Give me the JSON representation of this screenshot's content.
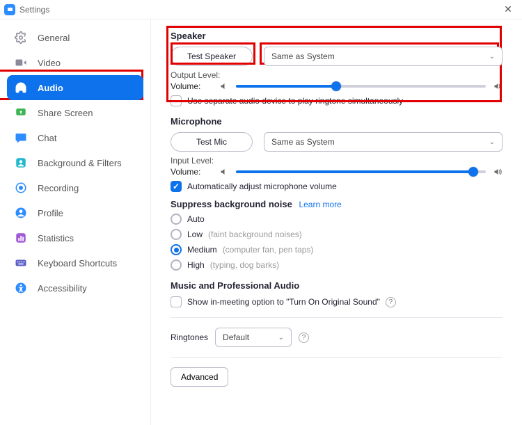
{
  "window": {
    "title": "Settings"
  },
  "sidebar": {
    "items": [
      {
        "label": "General"
      },
      {
        "label": "Video"
      },
      {
        "label": "Audio"
      },
      {
        "label": "Share Screen"
      },
      {
        "label": "Chat"
      },
      {
        "label": "Background & Filters"
      },
      {
        "label": "Recording"
      },
      {
        "label": "Profile"
      },
      {
        "label": "Statistics"
      },
      {
        "label": "Keyboard Shortcuts"
      },
      {
        "label": "Accessibility"
      }
    ],
    "active_index": 2
  },
  "speaker": {
    "title": "Speaker",
    "test_btn": "Test Speaker",
    "device": "Same as System",
    "output_level_label": "Output Level:",
    "volume_label": "Volume:",
    "volume_pct": 40,
    "separate_device_label": "Use separate audio device to play ringtone simultaneously",
    "separate_device_checked": false
  },
  "mic": {
    "title": "Microphone",
    "test_btn": "Test Mic",
    "device": "Same as System",
    "input_level_label": "Input Level:",
    "volume_label": "Volume:",
    "volume_pct": 95,
    "auto_adjust_label": "Automatically adjust microphone volume",
    "auto_adjust_checked": true
  },
  "noise": {
    "title": "Suppress background noise",
    "learn_more": "Learn more",
    "options": [
      {
        "label": "Auto",
        "hint": ""
      },
      {
        "label": "Low",
        "hint": "(faint background noises)"
      },
      {
        "label": "Medium",
        "hint": "(computer fan, pen taps)"
      },
      {
        "label": "High",
        "hint": "(typing, dog barks)"
      }
    ],
    "selected_index": 2
  },
  "music": {
    "title": "Music and Professional Audio",
    "original_sound_label": "Show in-meeting option to \"Turn On Original Sound\"",
    "original_sound_checked": false
  },
  "ringtones": {
    "label": "Ringtones",
    "value": "Default"
  },
  "advanced_btn": "Advanced"
}
